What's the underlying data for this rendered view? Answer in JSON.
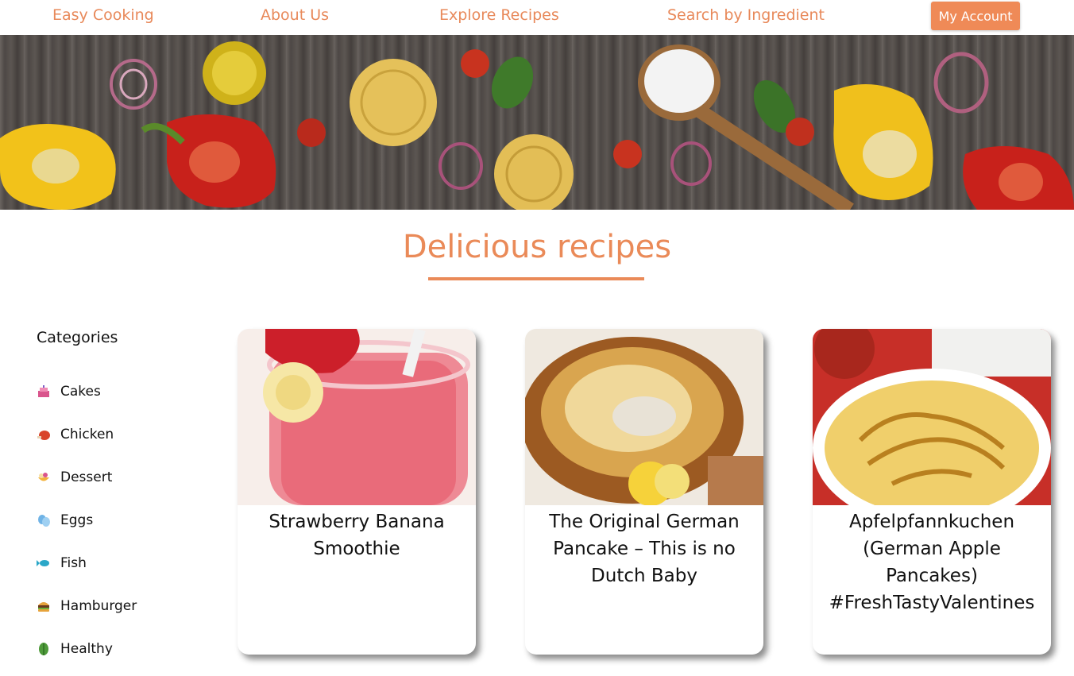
{
  "nav": {
    "brand": "Easy Cooking",
    "links": [
      "About Us",
      "Explore Recipes",
      "Search by Ingredient"
    ],
    "account_button": "My Account"
  },
  "hero": {
    "image": "vegetables-pasta-banner"
  },
  "page_title": "Delicious recipes",
  "sidebar": {
    "title": "Categories",
    "items": [
      {
        "label": "Cakes",
        "icon": "cake-icon"
      },
      {
        "label": "Chicken",
        "icon": "chicken-icon"
      },
      {
        "label": "Dessert",
        "icon": "dessert-icon"
      },
      {
        "label": "Eggs",
        "icon": "eggs-icon"
      },
      {
        "label": "Fish",
        "icon": "fish-icon"
      },
      {
        "label": "Hamburger",
        "icon": "hamburger-icon"
      },
      {
        "label": "Healthy",
        "icon": "healthy-icon"
      }
    ]
  },
  "recipes": [
    {
      "title": "Strawberry Banana Smoothie",
      "image": "smoothie-photo"
    },
    {
      "title": "The Original German Pancake – This is no Dutch Baby",
      "image": "german-pancake-photo"
    },
    {
      "title": "Apfelpfannkuchen (German Apple Pancakes) #FreshTastyValentines",
      "image": "apple-pancake-photo"
    }
  ],
  "colors": {
    "accent": "#ea8a58",
    "button": "#ef8a57"
  }
}
